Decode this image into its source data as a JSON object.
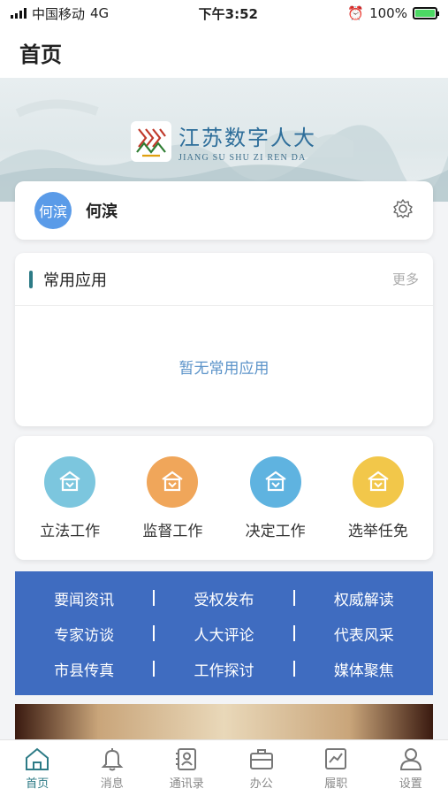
{
  "status_bar": {
    "carrier": "中国移动",
    "network": "4G",
    "time": "下午3:52",
    "battery": "100%"
  },
  "header": {
    "title": "首页"
  },
  "banner": {
    "name_cn": "江苏数字人大",
    "name_en": "JIANG SU SHU ZI REN DA"
  },
  "user": {
    "avatar_text": "何滨",
    "name": "何滨",
    "settings_icon": "gear-icon"
  },
  "apps": {
    "title": "常用应用",
    "more_label": "更多",
    "empty_text": "暂无常用应用"
  },
  "works": [
    {
      "label": "立法工作",
      "color": "#7cc6de"
    },
    {
      "label": "监督工作",
      "color": "#f0a65a"
    },
    {
      "label": "决定工作",
      "color": "#5fb3e0"
    },
    {
      "label": "选举任免",
      "color": "#f2c74a"
    }
  ],
  "links": [
    [
      "要闻资讯",
      "受权发布",
      "权威解读"
    ],
    [
      "专家访谈",
      "人大评论",
      "代表风采"
    ],
    [
      "市县传真",
      "工作探讨",
      "媒体聚焦"
    ]
  ],
  "colors": {
    "accent": "#2d7b86",
    "link_bg": "#3f6cc0",
    "avatar": "#5a9be8"
  },
  "tabbar": [
    {
      "label": "首页",
      "icon": "home-icon",
      "active": true
    },
    {
      "label": "消息",
      "icon": "bell-icon",
      "active": false
    },
    {
      "label": "通讯录",
      "icon": "contacts-icon",
      "active": false
    },
    {
      "label": "办公",
      "icon": "briefcase-icon",
      "active": false
    },
    {
      "label": "履职",
      "icon": "chart-icon",
      "active": false
    },
    {
      "label": "设置",
      "icon": "user-icon",
      "active": false
    }
  ]
}
